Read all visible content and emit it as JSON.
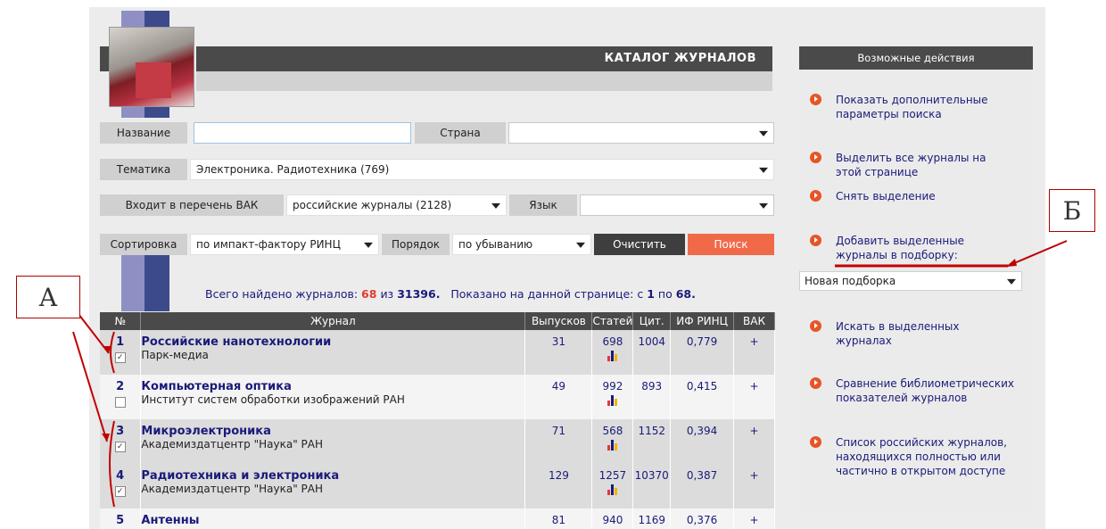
{
  "catalog": {
    "title": "КАТАЛОГ ЖУРНАЛОВ",
    "logo_text": "Journal covers"
  },
  "filters": {
    "name_label": "Название",
    "name_value": "",
    "country_label": "Страна",
    "country_value": "",
    "topic_label": "Тематика",
    "topic_value": "Электроника. Радиотехника  (769)",
    "vak_label": "Входит в перечень ВАК",
    "vak_value": "российские журналы  (2128)",
    "lang_label": "Язык",
    "lang_value": "",
    "sort_label": "Сортировка",
    "sort_value": "по импакт-фактору РИНЦ",
    "order_label": "Порядок",
    "order_value": "по убыванию",
    "clear_label": "Очистить",
    "search_label": "Поиск"
  },
  "summary": {
    "found_prefix": "Всего найдено журналов:",
    "found_count": "68",
    "of_word": "из",
    "total": "31396.",
    "shown_prefix": "Показано на данной странице: с",
    "from": "1",
    "to_word": "по",
    "to": "68."
  },
  "table": {
    "headers": [
      "№",
      "Журнал",
      "Выпусков",
      "Статей",
      "Цит.",
      "ИФ РИНЦ",
      "ВАК"
    ],
    "rows": [
      {
        "num": "1",
        "name": "Российские нанотехнологии",
        "publisher": "Парк-медиа",
        "issues": "31",
        "articles": "698",
        "citations": "1004",
        "impact": "0,779",
        "vak": "+",
        "checked": true
      },
      {
        "num": "2",
        "name": "Компьютерная оптика",
        "publisher": "Институт систем обработки изображений РАН",
        "issues": "49",
        "articles": "992",
        "citations": "893",
        "impact": "0,415",
        "vak": "+",
        "checked": false
      },
      {
        "num": "3",
        "name": "Микроэлектроника",
        "publisher": "Академиздатцентр \"Наука\" РАН",
        "issues": "71",
        "articles": "568",
        "citations": "1152",
        "impact": "0,394",
        "vak": "+",
        "checked": true
      },
      {
        "num": "4",
        "name": "Радиотехника и электроника",
        "publisher": "Академиздатцентр \"Наука\" РАН",
        "issues": "129",
        "articles": "1257",
        "citations": "10370",
        "impact": "0,387",
        "vak": "+",
        "checked": true
      },
      {
        "num": "5",
        "name": "Антенны",
        "publisher": "",
        "issues": "81",
        "articles": "940",
        "citations": "1169",
        "impact": "0,376",
        "vak": "+",
        "checked": false
      }
    ]
  },
  "sidebar": {
    "title": "Возможные действия",
    "actions": [
      "Показать дополнительные параметры поиска",
      "Выделить все журналы на этой странице",
      "Снять выделение",
      "Добавить выделенные журналы в подборку:",
      "Искать в выделенных журналах",
      "Сравнение библиометрических показателей журналов",
      "Список российских журналов, находящихся полностью или частично в открытом доступе"
    ],
    "collection_select": "Новая подборка"
  },
  "annotations": {
    "callout_a": "А",
    "callout_b": "Б",
    "annotation_color": "#c00000"
  },
  "colors": {
    "header_dark": "#4a4a4a",
    "accent_red": "#e03b30",
    "search_button": "#f06a4a",
    "link_blue": "#1a1a7a"
  }
}
